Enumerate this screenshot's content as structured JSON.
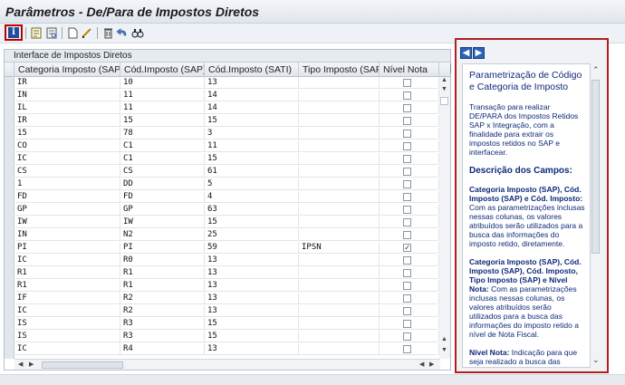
{
  "window": {
    "title": "Parâmetros - De/Para de Impostos Diretos"
  },
  "toolbar": {
    "buttons": [
      {
        "icon": "info-icon"
      },
      {
        "icon": "create-icon"
      },
      {
        "icon": "display-icon"
      },
      {
        "icon": "new-document-icon"
      },
      {
        "icon": "edit-icon"
      },
      {
        "icon": "delete-icon"
      },
      {
        "icon": "undo-icon"
      },
      {
        "icon": "find-icon"
      }
    ]
  },
  "grid": {
    "caption": "Interface de Impostos Diretos",
    "columns": [
      "Categoria Imposto (SAP)",
      "Cód.Imposto (SAP)",
      "Cód.Imposto (SATI)",
      "Tipo Imposto (SAP)",
      "Nível Nota"
    ],
    "rows": [
      {
        "cat": "IR",
        "cod_sap": "10",
        "cod_sati": "13",
        "tipo": "",
        "nivel": false
      },
      {
        "cat": "IN",
        "cod_sap": "11",
        "cod_sati": "14",
        "tipo": "",
        "nivel": false
      },
      {
        "cat": "IL",
        "cod_sap": "11",
        "cod_sati": "14",
        "tipo": "",
        "nivel": false
      },
      {
        "cat": "IR",
        "cod_sap": "15",
        "cod_sati": "15",
        "tipo": "",
        "nivel": false
      },
      {
        "cat": "15",
        "cod_sap": "78",
        "cod_sati": "3",
        "tipo": "",
        "nivel": false
      },
      {
        "cat": "CO",
        "cod_sap": "C1",
        "cod_sati": "11",
        "tipo": "",
        "nivel": false
      },
      {
        "cat": "IC",
        "cod_sap": "C1",
        "cod_sati": "15",
        "tipo": "",
        "nivel": false
      },
      {
        "cat": "CS",
        "cod_sap": "CS",
        "cod_sati": "61",
        "tipo": "",
        "nivel": false
      },
      {
        "cat": "1",
        "cod_sap": "DD",
        "cod_sati": "5",
        "tipo": "",
        "nivel": false
      },
      {
        "cat": "FD",
        "cod_sap": "FD",
        "cod_sati": "4",
        "tipo": "",
        "nivel": false
      },
      {
        "cat": "GP",
        "cod_sap": "GP",
        "cod_sati": "63",
        "tipo": "",
        "nivel": false
      },
      {
        "cat": "IW",
        "cod_sap": "IW",
        "cod_sati": "15",
        "tipo": "",
        "nivel": false
      },
      {
        "cat": "IN",
        "cod_sap": "N2",
        "cod_sati": "25",
        "tipo": "",
        "nivel": false
      },
      {
        "cat": "PI",
        "cod_sap": "PI",
        "cod_sati": "59",
        "tipo": "IPSN",
        "nivel": true
      },
      {
        "cat": "IC",
        "cod_sap": "R0",
        "cod_sati": "13",
        "tipo": "",
        "nivel": false
      },
      {
        "cat": "R1",
        "cod_sap": "R1",
        "cod_sati": "13",
        "tipo": "",
        "nivel": false
      },
      {
        "cat": "R1",
        "cod_sap": "R1",
        "cod_sati": "13",
        "tipo": "",
        "nivel": false
      },
      {
        "cat": "IF",
        "cod_sap": "R2",
        "cod_sati": "13",
        "tipo": "",
        "nivel": false
      },
      {
        "cat": "IC",
        "cod_sap": "R2",
        "cod_sati": "13",
        "tipo": "",
        "nivel": false
      },
      {
        "cat": "IS",
        "cod_sap": "R3",
        "cod_sati": "15",
        "tipo": "",
        "nivel": false
      },
      {
        "cat": "IS",
        "cod_sap": "R3",
        "cod_sati": "15",
        "tipo": "",
        "nivel": false
      },
      {
        "cat": "IC",
        "cod_sap": "R4",
        "cod_sati": "13",
        "tipo": "",
        "nivel": false
      }
    ]
  },
  "help": {
    "back_icon": "arrow-left-icon",
    "forward_icon": "arrow-right-icon",
    "close_icon": "close-icon",
    "title": "Parametrização de Código e Categoria de Imposto",
    "intro": "Transação para realizar DE/PARA dos Impostos Retidos SAP x Integração, com a finalidade para extrair os impostos retidos no SAP e interfacear.",
    "fields_heading": "Descrição dos Campos:",
    "p1_bold": "Categoria Imposto (SAP), Cód. Imposto (SAP) e Cód. Imposto:",
    "p1_text": " Com as parametrizações inclusas nessas colunas, os valores atribuídos serão utilizados para a busca das informações do imposto retido, diretamente.",
    "p2_bold": "Categoria Imposto (SAP), Cód. Imposto (SAP), Cód. Imposto, Tipo Imposto (SAP) e Nível Nota:",
    "p2_text": " Com as parametrizações inclusas nessas colunas, os valores atribuídos serão utilizados para a busca das informações do imposto retido a nível de Nota Fiscal.",
    "p3_bold": "Nível Nota:",
    "p3_text": " Indicação para que seja realizado a busca das informações do imposto a nível de Nota Fiscal."
  }
}
